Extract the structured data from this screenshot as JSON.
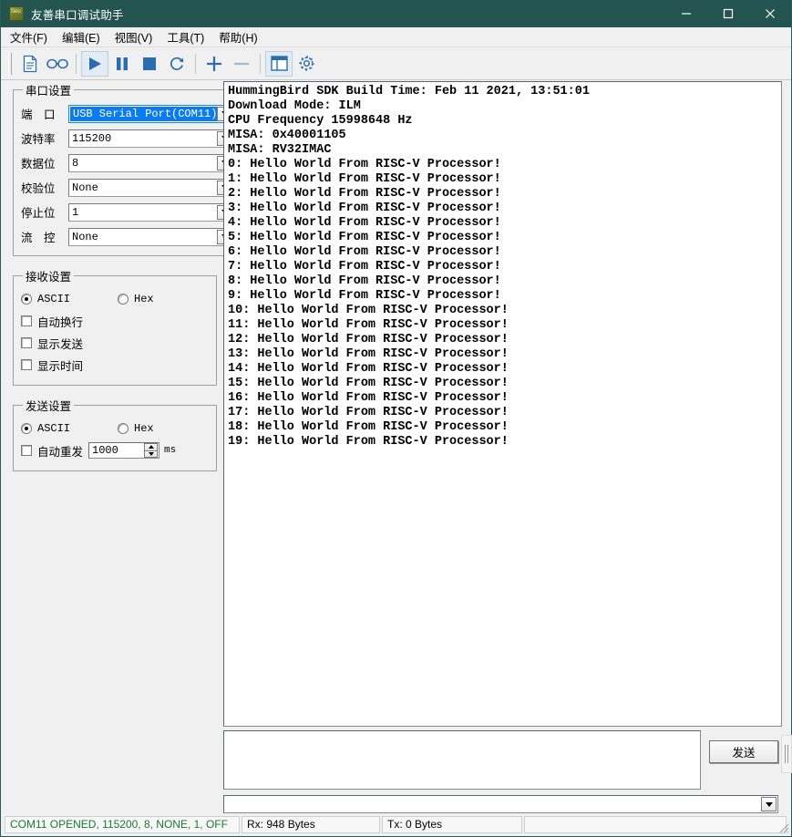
{
  "window": {
    "title": "友善串口调试助手",
    "icon": "app-icon",
    "minimize": "minimize-icon",
    "maximize": "maximize-icon",
    "close": "close-icon"
  },
  "menu": [
    {
      "label": "文件(F)"
    },
    {
      "label": "编辑(E)"
    },
    {
      "label": "视图(V)"
    },
    {
      "label": "工具(T)"
    },
    {
      "label": "帮助(H)"
    }
  ],
  "toolbar": [
    {
      "name": "new-document-icon"
    },
    {
      "name": "glasses-icon"
    },
    {
      "name": "play-icon"
    },
    {
      "name": "pause-icon"
    },
    {
      "name": "stop-icon"
    },
    {
      "name": "refresh-icon"
    },
    {
      "name": "plus-icon"
    },
    {
      "name": "minus-icon"
    },
    {
      "name": "panel-layout-icon"
    },
    {
      "name": "gear-icon"
    }
  ],
  "serial_settings": {
    "legend": "串口设置",
    "fields": [
      {
        "label": "端　口",
        "value": "USB Serial Port(COM11)",
        "selected": true
      },
      {
        "label": "波特率",
        "value": "115200",
        "selected": false
      },
      {
        "label": "数据位",
        "value": "8",
        "selected": false
      },
      {
        "label": "校验位",
        "value": "None",
        "selected": false
      },
      {
        "label": "停止位",
        "value": "1",
        "selected": false
      },
      {
        "label": "流　控",
        "value": "None",
        "selected": false
      }
    ]
  },
  "receive_settings": {
    "legend": "接收设置",
    "ascii_label": "ASCII",
    "hex_label": "Hex",
    "ascii_selected": true,
    "checkboxes": [
      {
        "label": "自动换行",
        "checked": false
      },
      {
        "label": "显示发送",
        "checked": false
      },
      {
        "label": "显示时间",
        "checked": false
      }
    ]
  },
  "send_settings": {
    "legend": "发送设置",
    "ascii_label": "ASCII",
    "hex_label": "Hex",
    "ascii_selected": true,
    "auto_resend_label": "自动重发",
    "auto_resend_checked": false,
    "interval_value": "1000",
    "interval_unit": "ms"
  },
  "terminal": {
    "lines": [
      "HummingBird SDK Build Time: Feb 11 2021, 13:51:01",
      "Download Mode: ILM",
      "CPU Frequency 15998648 Hz",
      "MISA: 0x40001105",
      "MISA: RV32IMAC",
      "0: Hello World From RISC-V Processor!",
      "1: Hello World From RISC-V Processor!",
      "2: Hello World From RISC-V Processor!",
      "3: Hello World From RISC-V Processor!",
      "4: Hello World From RISC-V Processor!",
      "5: Hello World From RISC-V Processor!",
      "6: Hello World From RISC-V Processor!",
      "7: Hello World From RISC-V Processor!",
      "8: Hello World From RISC-V Processor!",
      "9: Hello World From RISC-V Processor!",
      "10: Hello World From RISC-V Processor!",
      "11: Hello World From RISC-V Processor!",
      "12: Hello World From RISC-V Processor!",
      "13: Hello World From RISC-V Processor!",
      "14: Hello World From RISC-V Processor!",
      "15: Hello World From RISC-V Processor!",
      "16: Hello World From RISC-V Processor!",
      "17: Hello World From RISC-V Processor!",
      "18: Hello World From RISC-V Processor!",
      "19: Hello World From RISC-V Processor!"
    ]
  },
  "send_area": {
    "textarea_value": "",
    "button_label": "发送",
    "command_combo_value": ""
  },
  "statusbar": {
    "connection": "COM11 OPENED, 115200, 8, NONE, 1, OFF",
    "rx": "Rx: 948 Bytes",
    "tx": "Tx: 0 Bytes",
    "extra": ""
  },
  "colors": {
    "titlebar": "#245450",
    "selection": "#0a7cf0",
    "status_ok": "#1a7a32",
    "toolbar_icon": "#2a6db0"
  }
}
